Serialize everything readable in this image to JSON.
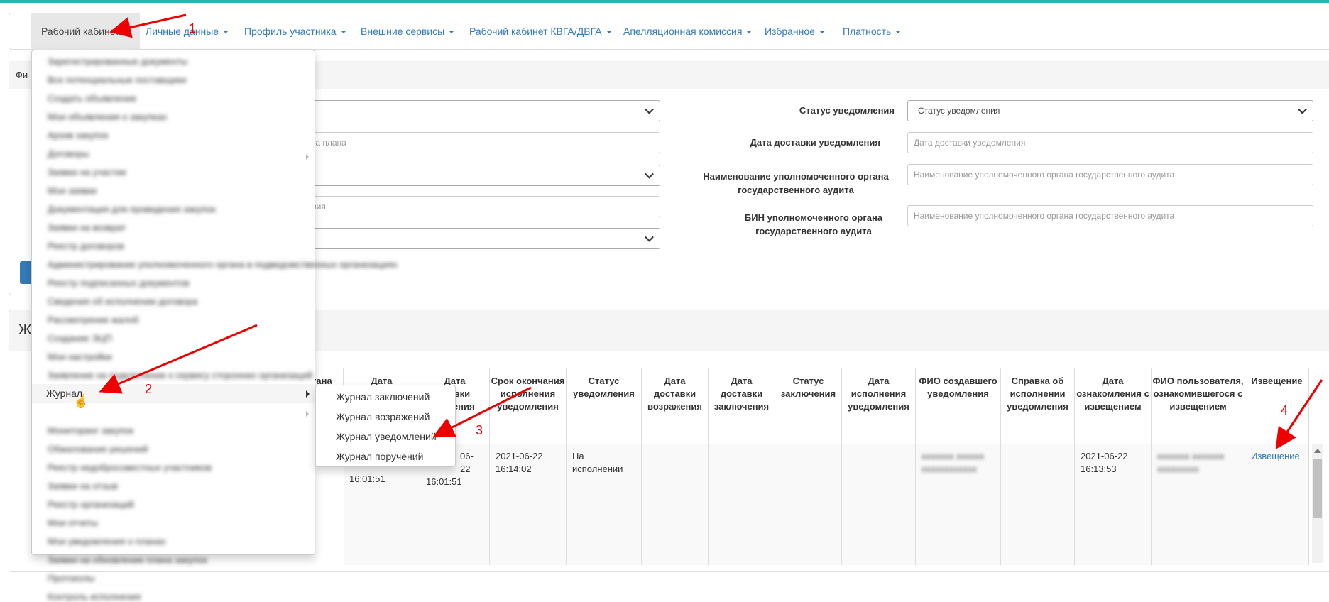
{
  "nav": {
    "items": [
      {
        "label": "Рабочий кабинет"
      },
      {
        "label": "Личные данные"
      },
      {
        "label": "Профиль участника"
      },
      {
        "label": "Внешние сервисы"
      },
      {
        "label": "Рабочий кабинет КВГА/ДВГА"
      },
      {
        "label": "Апелляционная комиссия"
      },
      {
        "label": "Избранное"
      },
      {
        "label": "Платность"
      }
    ]
  },
  "filter": {
    "head_fragment": "Фи",
    "left_placeholders": [
      "та плана",
      "ния"
    ],
    "status_label": "Статус уведомления",
    "status_value": "Статус уведомления",
    "delivery_label": "Дата доставки уведомления",
    "delivery_placeholder": "Дата доставки уведомления",
    "org_label": "Наименование уполномоченного органа государственного аудита",
    "org_placeholder": "Наименование уполномоченного органа государственного аудита",
    "bin_label": "БИН уполномоченного органа государственного аудита",
    "bin_placeholder": "Наименование уполномоченного органа государственного аудита",
    "side_fragment": "в"
  },
  "journal_fragment": "Ж",
  "menu": {
    "journal_label": "Журнал",
    "blurred_items": [
      "Зарегистрированные документы",
      "Все потенциальные поставщики",
      "Создать объявление",
      "Мои объявления о закупках",
      "Архив закупок",
      "Договоры",
      "Заявки на участие",
      "Мои заявки",
      "Документация для проведения закупок",
      "Заявки на возврат",
      "Реестр договоров",
      "Администрирование уполномоченного органа в подведомственных организациях",
      "Реестр подписанных документов",
      "Сведения об исполнении договора",
      "Рассмотрение жалоб",
      "Создание ЭЦП",
      "Мои настройки",
      "Заявление на подключение к сервису сторонних организаций",
      "Мониторинг закупок",
      "Обжалование решений",
      "Реестр недобросовестных участников",
      "Заявки на отзыв",
      "Реестр организаций",
      "Мои отчеты",
      "Мои уведомления о планах",
      "Заявки на обновление плана закупок",
      "Протоколы",
      "Контроль исполнения"
    ],
    "submenu": [
      "Журнал заключений",
      "Журнал возражений",
      "Журнал уведомлений",
      "Журнал поручений"
    ]
  },
  "table": {
    "header_fragments": {
      "organ": "гана",
      "date1": "Дата",
      "date2_a": "Дата",
      "date2_b": "ставки",
      "date2_c": "омления"
    },
    "headers": [
      "Срок окончания исполнения уведомления",
      "Статус уведомления",
      "Дата доставки возражения",
      "Дата доставки заключения",
      "Статус заключения",
      "Дата исполнения уведомления",
      "ФИО создавшего уведомления",
      "Справка об исполнении уведомления",
      "Дата ознакомления с извещением",
      "ФИО пользователя, ознакомившегося с извещением",
      "Извещение"
    ],
    "row": {
      "frag1": "16:01:51",
      "frag2_a": "06-22",
      "frag2_b": "16:01:51",
      "deadline": "2021-06-22 16:14:02",
      "status": "На исполнении",
      "creator": "ххххххх хххххх хххххххххххх",
      "ack_date": "2021-06-22 16:13:53",
      "ack_user": "ххххххх ххххххх ххххххххх",
      "link": "Извещение"
    }
  },
  "annotations": [
    "1",
    "2",
    "3",
    "4"
  ]
}
